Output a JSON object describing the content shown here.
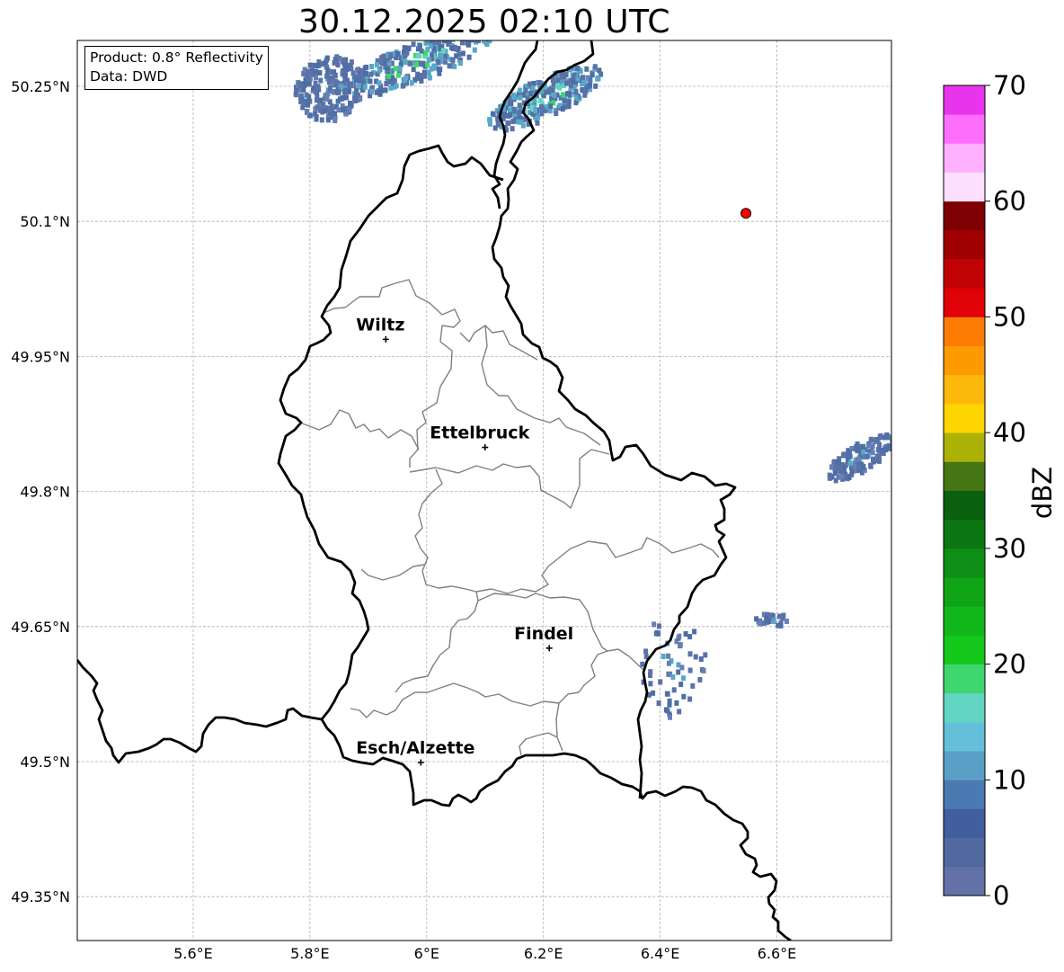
{
  "title": "30.12.2025 02:10 UTC",
  "info_box": {
    "product": "Product: 0.8° Reflectivity",
    "data": "Data: DWD"
  },
  "axes": {
    "x_ticks": [
      {
        "value": 5.6,
        "label": "5.6°E"
      },
      {
        "value": 5.8,
        "label": "5.8°E"
      },
      {
        "value": 6.0,
        "label": "6°E"
      },
      {
        "value": 6.2,
        "label": "6.2°E"
      },
      {
        "value": 6.4,
        "label": "6.4°E"
      },
      {
        "value": 6.6,
        "label": "6.6°E"
      }
    ],
    "y_ticks": [
      {
        "value": 50.25,
        "label": "50.25°N"
      },
      {
        "value": 50.1,
        "label": "50.1°N"
      },
      {
        "value": 49.95,
        "label": "49.95°N"
      },
      {
        "value": 49.8,
        "label": "49.8°N"
      },
      {
        "value": 49.65,
        "label": "49.65°N"
      },
      {
        "value": 49.5,
        "label": "49.5°N"
      },
      {
        "value": 49.35,
        "label": "49.35°N"
      }
    ],
    "lon_range": [
      5.4,
      6.8
    ],
    "lat_range": [
      49.3,
      50.3
    ],
    "grid": true
  },
  "cities": [
    {
      "name": "Wiltz",
      "lon": 5.93,
      "lat": 49.969
    },
    {
      "name": "Ettelbruck",
      "lon": 6.1,
      "lat": 49.849
    },
    {
      "name": "Findel",
      "lon": 6.21,
      "lat": 49.626
    },
    {
      "name": "Esch/Alzette",
      "lon": 5.99,
      "lat": 49.499
    }
  ],
  "radar_marker": {
    "lon": 6.547,
    "lat": 50.109,
    "color": "#ff0000"
  },
  "colorbar": {
    "label": "dBZ",
    "min": 0,
    "max": 70,
    "ticks": [
      "0",
      "10",
      "20",
      "30",
      "40",
      "50",
      "60",
      "70"
    ],
    "colors": [
      "#6272a6",
      "#51689f",
      "#425e9e",
      "#4a7ab1",
      "#5aa0c6",
      "#64c0d9",
      "#62d5c3",
      "#3ed66e",
      "#14c81c",
      "#11b71a",
      "#0fa416",
      "#0e8e14",
      "#0b7712",
      "#0a600f",
      "#467514",
      "#acb107",
      "#fed500",
      "#fdb90b",
      "#fd9a02",
      "#fd7d04",
      "#e00207",
      "#c10205",
      "#a00204",
      "#7e0002",
      "#fce0fe",
      "#fdb1fe",
      "#fd6efd",
      "#e834ec"
    ]
  },
  "echoes": [
    {
      "lon": 5.83,
      "lat": 50.25,
      "intensity": "weak"
    },
    {
      "lon": 5.98,
      "lat": 50.28,
      "intensity": "moderate"
    },
    {
      "lon": 6.2,
      "lat": 50.24,
      "intensity": "moderate"
    },
    {
      "lon": 6.74,
      "lat": 49.84,
      "intensity": "weak"
    },
    {
      "lon": 6.42,
      "lat": 49.61,
      "intensity": "weak"
    },
    {
      "lon": 6.59,
      "lat": 49.66,
      "intensity": "weak"
    }
  ]
}
